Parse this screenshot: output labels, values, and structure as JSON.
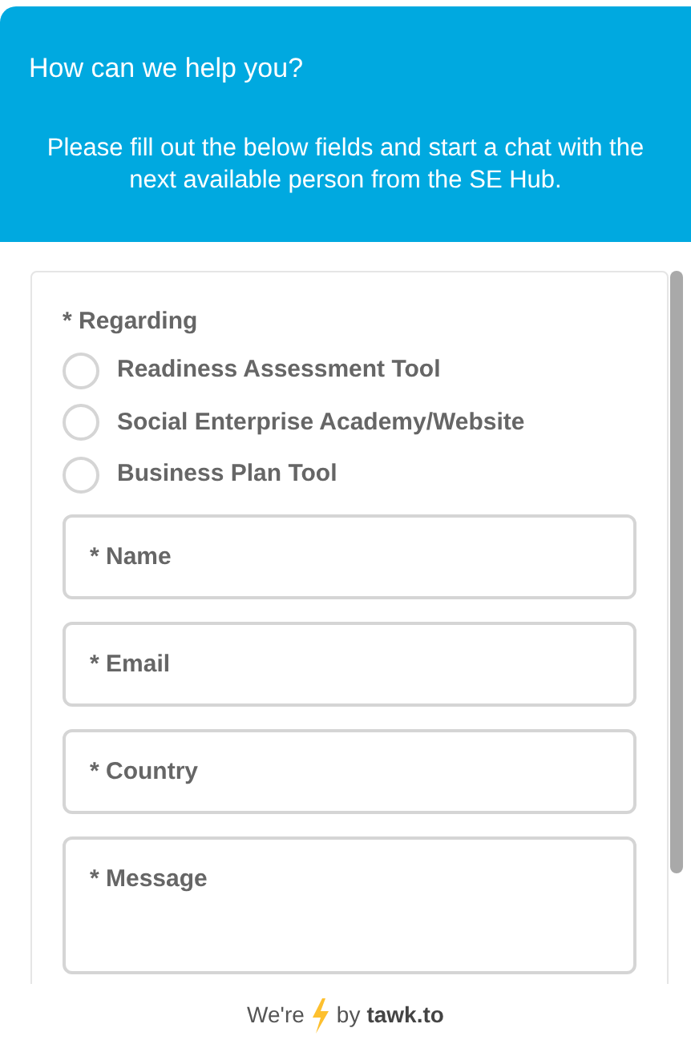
{
  "header": {
    "title": "How can we help you?",
    "subtitle": "Please fill out the below fields and start a chat with the next available person from the SE Hub."
  },
  "form": {
    "question": "* Regarding",
    "options": [
      {
        "label": "Readiness Assessment Tool",
        "selected": false
      },
      {
        "label": "Social Enterprise Academy/Website",
        "selected": false
      },
      {
        "label": "Business Plan Tool",
        "selected": false
      }
    ],
    "fields": [
      {
        "kind": "input",
        "placeholder": "* Name"
      },
      {
        "kind": "input",
        "placeholder": "* Email"
      },
      {
        "kind": "input",
        "placeholder": "* Country"
      },
      {
        "kind": "textarea",
        "placeholder": "* Message"
      }
    ]
  },
  "footer": {
    "before": "We're",
    "after": "by",
    "brand": "tawk.to"
  }
}
